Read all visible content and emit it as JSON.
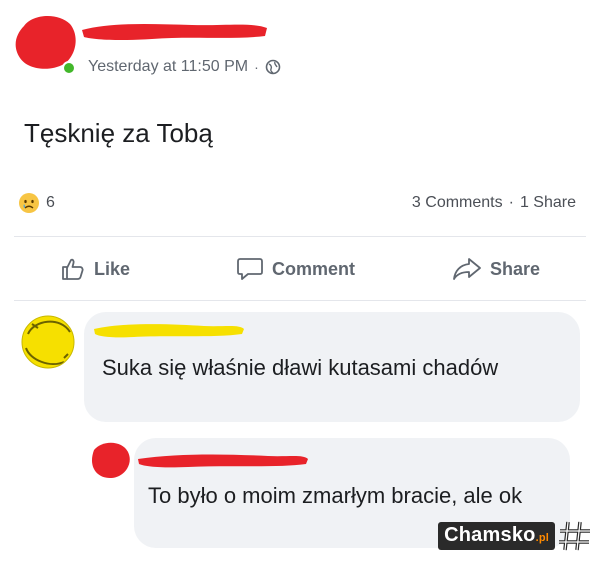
{
  "post": {
    "timestamp": "Yesterday at 11:50 PM",
    "separator": "·",
    "privacy_icon": "globe-icon",
    "text": "Tęsknię za Tobą",
    "reaction_icon": "sad-reaction-icon",
    "reaction_count": "6",
    "comments_count": "3 Comments",
    "stats_separator": "·",
    "shares_count": "1 Share"
  },
  "actions": {
    "like_label": "Like",
    "comment_label": "Comment",
    "share_label": "Share"
  },
  "comments": [
    {
      "text": "Suka się właśnie dławi kutasami chadów"
    },
    {
      "text": "To było o moim zmarłym bracie, ale ok"
    }
  ],
  "watermark": {
    "brand": "Chamsko",
    "suffix": ".pl",
    "logo_icon": "hash-logo-icon"
  },
  "colors": {
    "redaction_red": "#e8232a",
    "redaction_yellow": "#f6e000",
    "online_green": "#42b72a",
    "bubble_gray": "#f0f2f5",
    "muted_text": "#606770"
  }
}
